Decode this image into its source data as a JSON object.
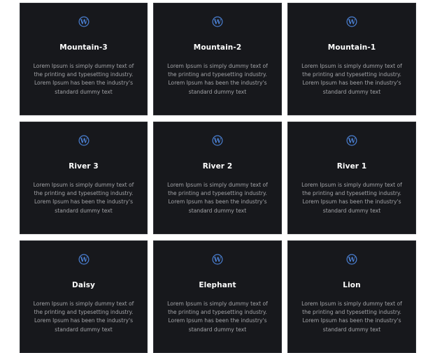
{
  "colors": {
    "card_background": "#17181c",
    "icon": "#4a7fd1",
    "title": "#ffffff",
    "body_text": "#a3a4a8"
  },
  "cards": [
    {
      "icon": "wordpress-icon",
      "title": "Mountain-3",
      "text": "Lorem Ipsum is simply dummy text of the printing and typesetting industry. Lorem Ipsum has been the industry's standard dummy text"
    },
    {
      "icon": "wordpress-icon",
      "title": "Mountain-2",
      "text": "Lorem Ipsum is simply dummy text of the printing and typesetting industry. Lorem Ipsum has been the industry's standard dummy text"
    },
    {
      "icon": "wordpress-icon",
      "title": "Mountain-1",
      "text": "Lorem Ipsum is simply dummy text of the printing and typesetting industry. Lorem Ipsum has been the industry's standard dummy text"
    },
    {
      "icon": "wordpress-icon",
      "title": "River 3",
      "text": "Lorem Ipsum is simply dummy text of the printing and typesetting industry. Lorem Ipsum has been the industry's standard dummy text"
    },
    {
      "icon": "wordpress-icon",
      "title": "River 2",
      "text": "Lorem Ipsum is simply dummy text of the printing and typesetting industry. Lorem Ipsum has been the industry's standard dummy text"
    },
    {
      "icon": "wordpress-icon",
      "title": "River 1",
      "text": "Lorem Ipsum is simply dummy text of the printing and typesetting industry. Lorem Ipsum has been the industry's standard dummy text"
    },
    {
      "icon": "wordpress-icon",
      "title": "Daisy",
      "text": "Lorem Ipsum is simply dummy text of the printing and typesetting industry. Lorem Ipsum has been the industry's standard dummy text"
    },
    {
      "icon": "wordpress-icon",
      "title": "Elephant",
      "text": "Lorem Ipsum is simply dummy text of the printing and typesetting industry. Lorem Ipsum has been the industry's standard dummy text"
    },
    {
      "icon": "wordpress-icon",
      "title": "Lion",
      "text": "Lorem Ipsum is simply dummy text of the printing and typesetting industry. Lorem Ipsum has been the industry's standard dummy text"
    }
  ]
}
